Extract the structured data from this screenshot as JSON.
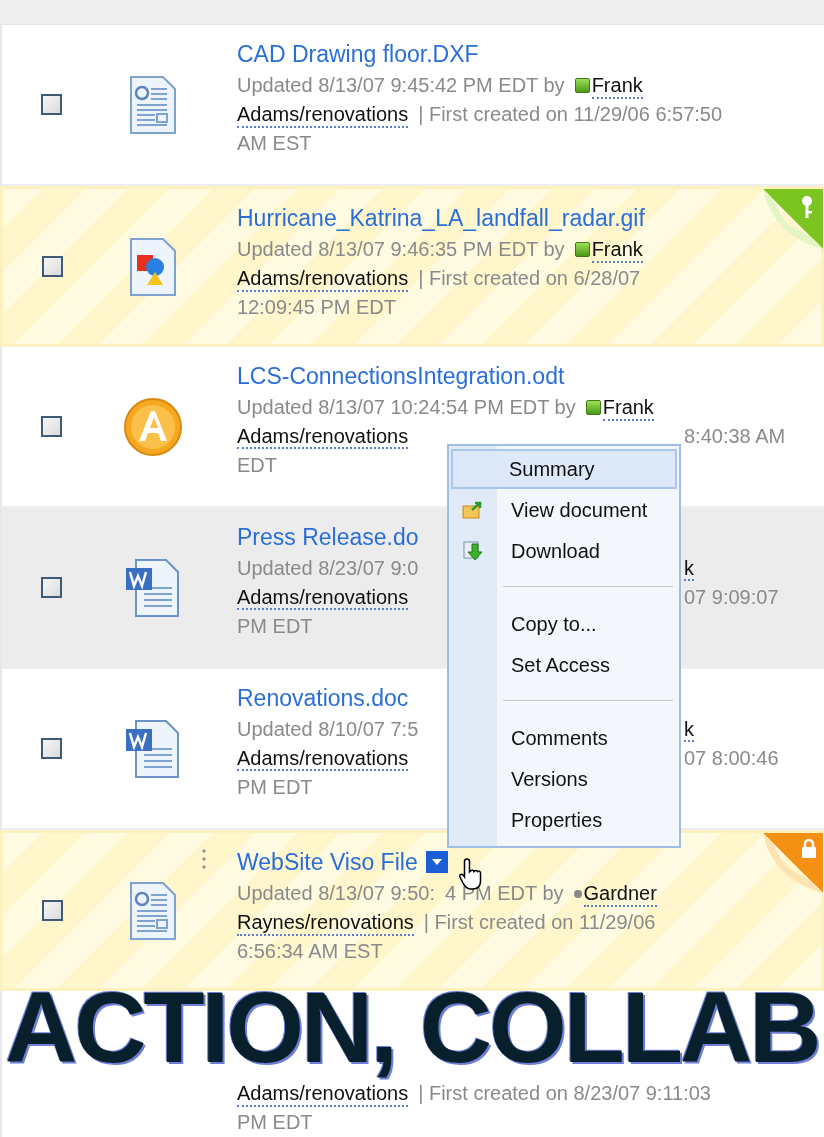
{
  "rows": [
    {
      "checked": false,
      "kind": "template",
      "flagged": false,
      "hovered": false,
      "title": "CAD Drawing floor.DXF",
      "lines": [
        {
          "kind": "full",
          "segments": [
            {
              "kind": "plain",
              "text": "Updated 8/13/07 9:45:42 PM EDT by"
            },
            {
              "kind": "author",
              "text": "Frank",
              "online": true
            }
          ]
        },
        {
          "kind": "full",
          "segments": [
            {
              "kind": "author",
              "text": "Adams/renovations"
            },
            {
              "kind": "plain",
              "text": "| First created on 11/29/06 6:57:50"
            }
          ]
        },
        {
          "kind": "full",
          "segments": [
            {
              "kind": "plain",
              "text": "AM EST"
            }
          ]
        }
      ]
    },
    {
      "checked": false,
      "kind": "image",
      "flagged": true,
      "corner": {
        "kind": "key"
      },
      "hovered": false,
      "title": "Hurricane_Katrina_LA_landfall_radar.gif",
      "lines": [
        {
          "kind": "full",
          "segments": [
            {
              "kind": "plain",
              "text": "Updated 8/13/07 9:46:35 PM EDT by"
            },
            {
              "kind": "author",
              "text": "Frank",
              "online": true
            }
          ]
        },
        {
          "kind": "full",
          "segments": [
            {
              "kind": "author",
              "text": "Adams/renovations"
            },
            {
              "kind": "plain",
              "text": "| First created on 6/28/07"
            }
          ]
        },
        {
          "kind": "full",
          "segments": [
            {
              "kind": "plain",
              "text": "12:09:45 PM EDT"
            }
          ]
        }
      ]
    },
    {
      "checked": false,
      "kind": "font",
      "flagged": false,
      "hovered": false,
      "title": "LCS-ConnectionsIntegration.odt",
      "lines": [
        {
          "kind": "full",
          "segments": [
            {
              "kind": "plain",
              "text": "Updated 8/13/07 10:24:54 PM EDT by"
            },
            {
              "kind": "author",
              "text": "Frank",
              "online": true
            }
          ]
        },
        {
          "kind": "split",
          "left": [
            {
              "kind": "author",
              "text": "Adams/renovations"
            }
          ],
          "right": [
            {
              "kind": "plain",
              "text": "8:40:38 AM"
            }
          ]
        },
        {
          "kind": "full",
          "segments": [
            {
              "kind": "plain",
              "text": "EDT"
            }
          ]
        }
      ]
    },
    {
      "checked": false,
      "kind": "word",
      "flagged": false,
      "hovered": true,
      "title": "Press Release.do",
      "lines": [
        {
          "kind": "split",
          "left": [
            {
              "kind": "plain",
              "text": "Updated 8/23/07 9:0"
            }
          ],
          "right": [
            {
              "kind": "author",
              "text": "k"
            }
          ]
        },
        {
          "kind": "split",
          "left": [
            {
              "kind": "author",
              "text": "Adams/renovations"
            }
          ],
          "right": [
            {
              "kind": "plain",
              "text": "07 9:09:07"
            }
          ]
        },
        {
          "kind": "full",
          "segments": [
            {
              "kind": "plain",
              "text": "PM EDT"
            }
          ]
        }
      ]
    },
    {
      "checked": false,
      "kind": "word",
      "flagged": false,
      "hovered": false,
      "title": "Renovations.doc",
      "lines": [
        {
          "kind": "split",
          "left": [
            {
              "kind": "plain",
              "text": "Updated 8/10/07 7:5"
            }
          ],
          "right": [
            {
              "kind": "author",
              "text": "k"
            }
          ]
        },
        {
          "kind": "split",
          "left": [
            {
              "kind": "author",
              "text": "Adams/renovations"
            }
          ],
          "right": [
            {
              "kind": "plain",
              "text": "07 8:00:46"
            }
          ]
        },
        {
          "kind": "full",
          "segments": [
            {
              "kind": "plain",
              "text": "PM EDT"
            }
          ]
        }
      ]
    },
    {
      "checked": false,
      "kind": "template",
      "flagged": true,
      "corner": {
        "kind": "lock"
      },
      "hovered": false,
      "menu_open": true,
      "title": "WebSite Viso File",
      "lines": [
        {
          "kind": "full",
          "segments": [
            {
              "kind": "plain",
              "text": "Updated 8/13/07 9:50:"
            },
            {
              "kind": "plain",
              "text": "4 PM EDT by"
            },
            {
              "kind": "author",
              "text": "Gardner",
              "online": false
            }
          ]
        },
        {
          "kind": "full",
          "segments": [
            {
              "kind": "author",
              "text": "Raynes/renovations"
            },
            {
              "kind": "plain",
              "text": "| First created on 11/29/06"
            }
          ]
        },
        {
          "kind": "full",
          "segments": [
            {
              "kind": "plain",
              "text": "6:56:34 AM EST"
            }
          ]
        }
      ]
    },
    {
      "kind": "caption",
      "flagged": false,
      "hovered": false,
      "lines": [
        {
          "kind": "full",
          "segments": [
            {
              "kind": "author",
              "text": "Adams/renovations"
            },
            {
              "kind": "plain",
              "text": "| First created on 8/23/07 9:11:03"
            }
          ]
        },
        {
          "kind": "full",
          "segments": [
            {
              "kind": "plain",
              "text": "PM EDT"
            }
          ]
        }
      ]
    }
  ],
  "context_menu": [
    {
      "kind": "item",
      "label": "Summary",
      "selected": true
    },
    {
      "kind": "view",
      "label": "View document",
      "selected": false
    },
    {
      "kind": "download",
      "label": "Download",
      "selected": false
    },
    {
      "kind": "separator"
    },
    {
      "kind": "item",
      "label": "Copy to...",
      "selected": false
    },
    {
      "kind": "item",
      "label": "Set Access",
      "selected": false
    },
    {
      "kind": "separator"
    },
    {
      "kind": "item",
      "label": "Comments",
      "selected": false
    },
    {
      "kind": "item",
      "label": "Versions",
      "selected": false
    },
    {
      "kind": "item",
      "label": "Properties",
      "selected": false
    }
  ],
  "caption": "ACTION, COLLAB"
}
